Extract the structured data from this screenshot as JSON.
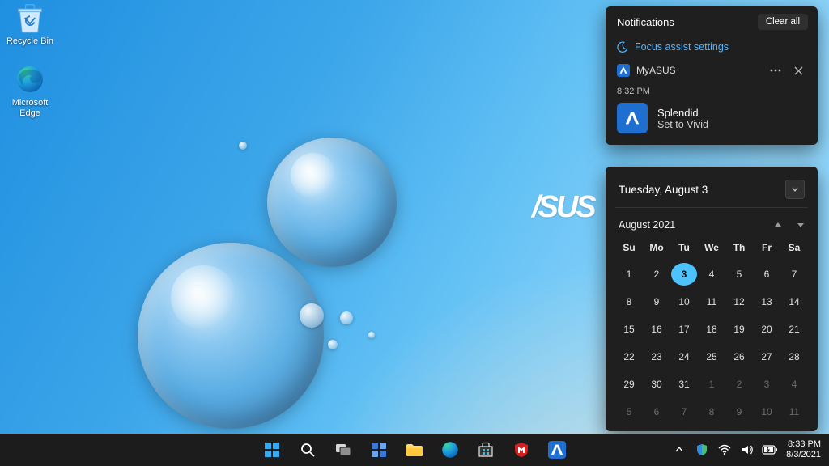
{
  "desktop": {
    "wallpaper_brand": "/SUS",
    "icons": {
      "recycle_bin": "Recycle Bin",
      "edge": "Microsoft\nEdge"
    }
  },
  "notifications": {
    "header": "Notifications",
    "clear_all": "Clear all",
    "focus_assist": "Focus assist settings",
    "card": {
      "app": "MyASUS",
      "time": "8:32 PM",
      "title": "Splendid",
      "subtitle": "Set to Vivid"
    }
  },
  "calendar": {
    "today_label": "Tuesday, August 3",
    "month_label": "August 2021",
    "dow": [
      "Su",
      "Mo",
      "Tu",
      "We",
      "Th",
      "Fr",
      "Sa"
    ],
    "weeks": [
      [
        {
          "d": 1
        },
        {
          "d": 2
        },
        {
          "d": 3,
          "today": true
        },
        {
          "d": 4
        },
        {
          "d": 5
        },
        {
          "d": 6
        },
        {
          "d": 7
        }
      ],
      [
        {
          "d": 8
        },
        {
          "d": 9
        },
        {
          "d": 10
        },
        {
          "d": 11
        },
        {
          "d": 12
        },
        {
          "d": 13
        },
        {
          "d": 14
        }
      ],
      [
        {
          "d": 15
        },
        {
          "d": 16
        },
        {
          "d": 17
        },
        {
          "d": 18
        },
        {
          "d": 19
        },
        {
          "d": 20
        },
        {
          "d": 21
        }
      ],
      [
        {
          "d": 22
        },
        {
          "d": 23
        },
        {
          "d": 24
        },
        {
          "d": 25
        },
        {
          "d": 26
        },
        {
          "d": 27
        },
        {
          "d": 28
        }
      ],
      [
        {
          "d": 29
        },
        {
          "d": 30
        },
        {
          "d": 31
        },
        {
          "d": 1,
          "dim": true
        },
        {
          "d": 2,
          "dim": true
        },
        {
          "d": 3,
          "dim": true
        },
        {
          "d": 4,
          "dim": true
        }
      ],
      [
        {
          "d": 5,
          "dim": true
        },
        {
          "d": 6,
          "dim": true
        },
        {
          "d": 7,
          "dim": true
        },
        {
          "d": 8,
          "dim": true
        },
        {
          "d": 9,
          "dim": true
        },
        {
          "d": 10,
          "dim": true
        },
        {
          "d": 11,
          "dim": true
        }
      ]
    ]
  },
  "taskbar": {
    "clock_time": "8:33 PM",
    "clock_date": "8/3/2021"
  }
}
